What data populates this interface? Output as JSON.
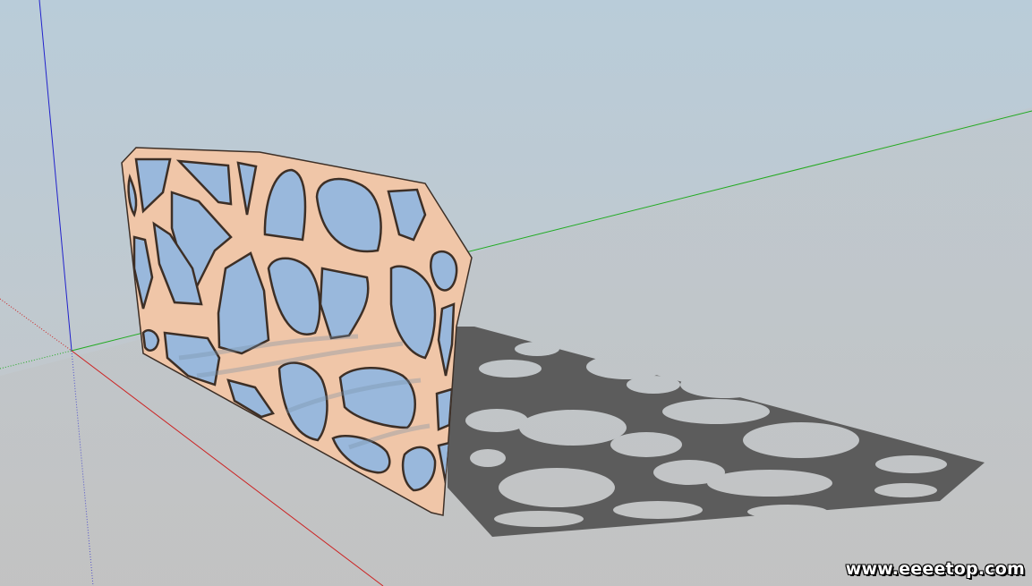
{
  "viewport": {
    "name": "3d-modeling-viewport",
    "sky_top_color": "#b9ccd9",
    "sky_bottom_color": "#c6c6c6",
    "ground_color": "#c0c0c0"
  },
  "axes": {
    "x_color": "#cc2222",
    "y_color": "#22aa22",
    "z_color": "#2222cc"
  },
  "model": {
    "name": "voronoi-screen-panel",
    "face_color": "#f0c6a8",
    "edge_color": "#3d2f26",
    "glass_color": "#99b8dc",
    "shadow_color": "#5c5c5c"
  },
  "watermark": {
    "text": "www.eeeetop.com"
  }
}
